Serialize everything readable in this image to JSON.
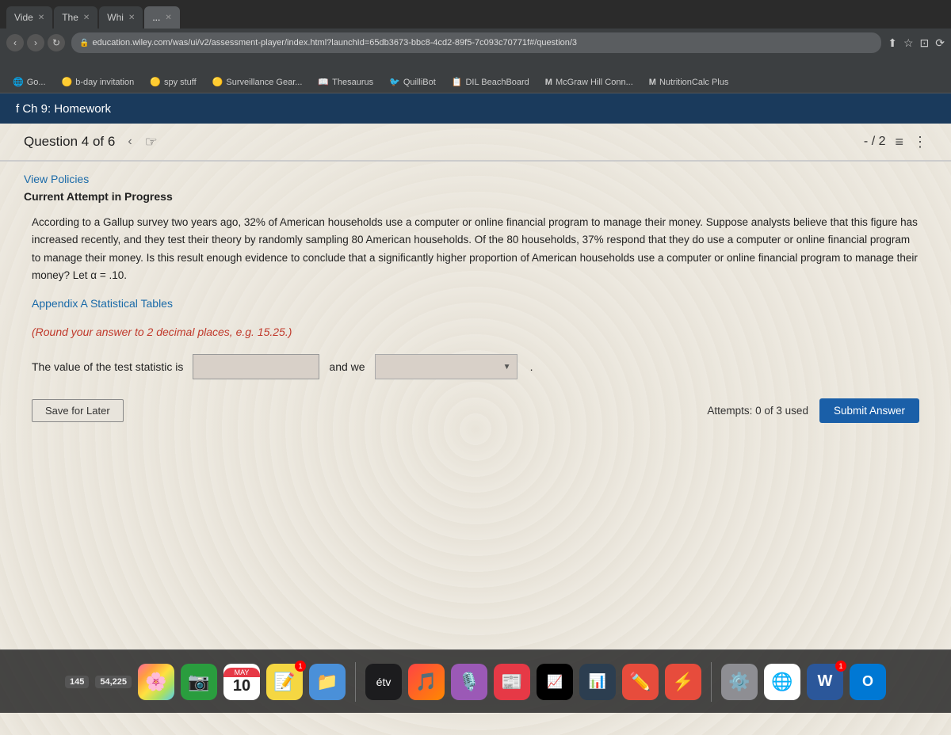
{
  "browser": {
    "url": "education.wiley.com/was/ui/v2/assessment-player/index.html?launchId=65db3673-bbc8-4cd2-89f5-7c093c70771f#/question/3",
    "tabs": [
      {
        "label": "Vide",
        "active": false,
        "id": "tab-vide"
      },
      {
        "label": "The",
        "active": false,
        "id": "tab-the"
      },
      {
        "label": "Whi",
        "active": false,
        "id": "tab-whi"
      },
      {
        "label": "...",
        "active": true,
        "id": "tab-active"
      }
    ],
    "bookmarks": [
      {
        "label": "Go...",
        "icon": "🌐"
      },
      {
        "label": "b-day invitation",
        "icon": "🟡"
      },
      {
        "label": "spy stuff",
        "icon": "🟡"
      },
      {
        "label": "Surveillance Gear...",
        "icon": "🟡"
      },
      {
        "label": "Thesaurus",
        "icon": "📖"
      },
      {
        "label": "QuilliBot",
        "icon": "🐦"
      },
      {
        "label": "DIL BeachBoard",
        "icon": "📋"
      },
      {
        "label": "M McGraw Hill Conn...",
        "icon": "M"
      },
      {
        "label": "M NutritionCalc Plus",
        "icon": "M"
      }
    ]
  },
  "page_header": {
    "title": "f Ch 9: Homework"
  },
  "question": {
    "label": "Question 4 of 6",
    "score": "- / 2",
    "view_policies_label": "View Policies",
    "current_attempt_label": "Current Attempt in Progress",
    "body": "According to a Gallup survey two years ago, 32% of American households use a computer or online financial program to manage their money. Suppose analysts believe that this figure has increased recently, and they test their theory by randomly sampling 80 American households. Of the 80 households, 37% respond that they do use a computer or online financial program to manage their money. Is this result enough evidence to conclude that a significantly higher proportion of American households use a computer or online financial program to manage their money? Let α = .10.",
    "appendix_label": "Appendix A Statistical Tables",
    "round_instruction": "(Round your answer to 2 decimal places, e.g. 15.25.)",
    "answer_prefix": "The value of the test statistic is",
    "and_we_label": "and we",
    "period": ".",
    "attempts_label": "Attempts: 0 of 3 used",
    "submit_label": "Submit Answer",
    "save_later_label": "Save for Later"
  },
  "dock": {
    "items": [
      {
        "label": "145",
        "icon": "🔴",
        "type": "counter",
        "value": "145"
      },
      {
        "label": "54,225",
        "icon": "🟡",
        "type": "counter",
        "value": "54,225"
      },
      {
        "label": "Photos",
        "icon": "🌸",
        "type": "app"
      },
      {
        "label": "FaceTime",
        "icon": "📷",
        "type": "app"
      },
      {
        "label": "May 10",
        "icon": "📅",
        "type": "app",
        "sub": "10"
      },
      {
        "label": "Notes",
        "icon": "📝",
        "type": "app",
        "badge": "1"
      },
      {
        "label": "Files",
        "icon": "📁",
        "type": "app"
      },
      {
        "label": "TV",
        "icon": "📺",
        "type": "app",
        "applabel": "étv"
      },
      {
        "label": "Music",
        "icon": "🎵",
        "type": "app"
      },
      {
        "label": "Podcasts",
        "icon": "🎙️",
        "type": "app"
      },
      {
        "label": "News",
        "icon": "📰",
        "type": "app"
      },
      {
        "label": "Stocks",
        "icon": "📈",
        "type": "app"
      },
      {
        "label": "Charts",
        "icon": "📊",
        "type": "app"
      },
      {
        "label": "Notability",
        "icon": "✏️",
        "type": "app"
      },
      {
        "label": "Spark",
        "icon": "⚡",
        "type": "app"
      },
      {
        "label": "Settings",
        "icon": "⚙️",
        "type": "app"
      },
      {
        "label": "Chrome",
        "icon": "🌐",
        "type": "app"
      },
      {
        "label": "Word",
        "icon": "W",
        "type": "app",
        "badge": "1"
      },
      {
        "label": "Outlook",
        "icon": "O",
        "type": "app"
      }
    ]
  }
}
